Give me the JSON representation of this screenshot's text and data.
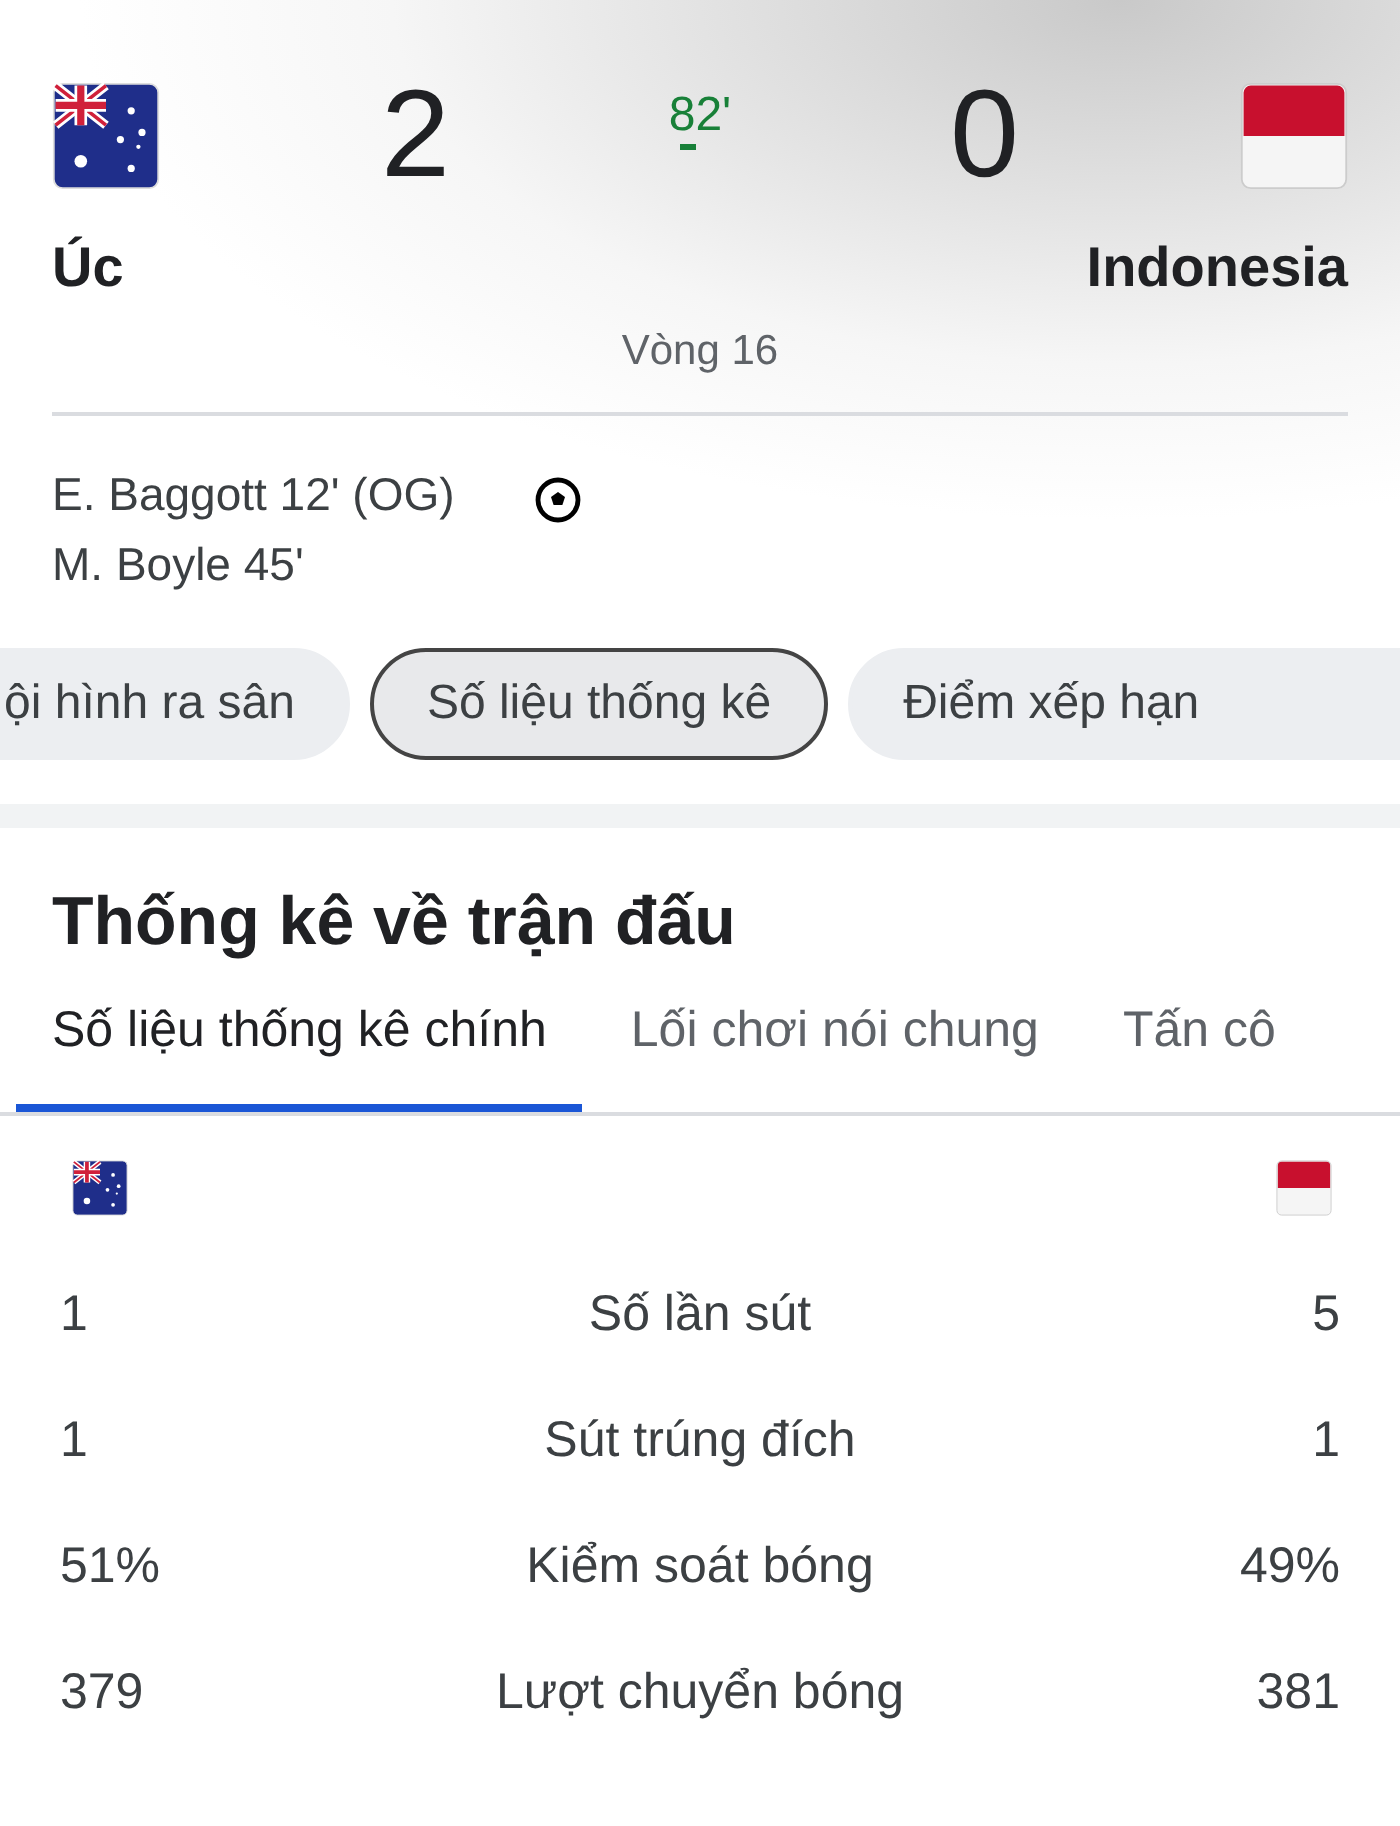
{
  "match": {
    "home": {
      "name": "Úc",
      "score": "2",
      "kind": "australia"
    },
    "away": {
      "name": "Indonesia",
      "score": "0",
      "kind": "indonesia"
    },
    "minute": "82'",
    "live": true,
    "round": "Vòng 16"
  },
  "scorers": [
    "E. Baggott 12' (OG)",
    "M. Boyle 45'"
  ],
  "chips": [
    {
      "label": "ội hình ra sân",
      "selected": false,
      "kind": "cutleft"
    },
    {
      "label": "Số liệu thống kê",
      "selected": true,
      "kind": "full"
    },
    {
      "label": "Điểm xếp hạn",
      "selected": false,
      "kind": "cutright"
    }
  ],
  "stats": {
    "title": "Thống kê về trận đấu",
    "tabs": [
      {
        "label": "Số liệu thống kê chính",
        "selected": true
      },
      {
        "label": "Lối chơi nói chung",
        "selected": false
      },
      {
        "label": "Tấn cô",
        "selected": false
      }
    ],
    "rows": [
      {
        "home": "1",
        "label": "Số lần sút",
        "away": "5"
      },
      {
        "home": "1",
        "label": "Sút trúng đích",
        "away": "1"
      },
      {
        "home": "51%",
        "label": "Kiểm soát bóng",
        "away": "49%"
      },
      {
        "home": "379",
        "label": "Lượt chuyển bóng",
        "away": "381"
      }
    ]
  }
}
